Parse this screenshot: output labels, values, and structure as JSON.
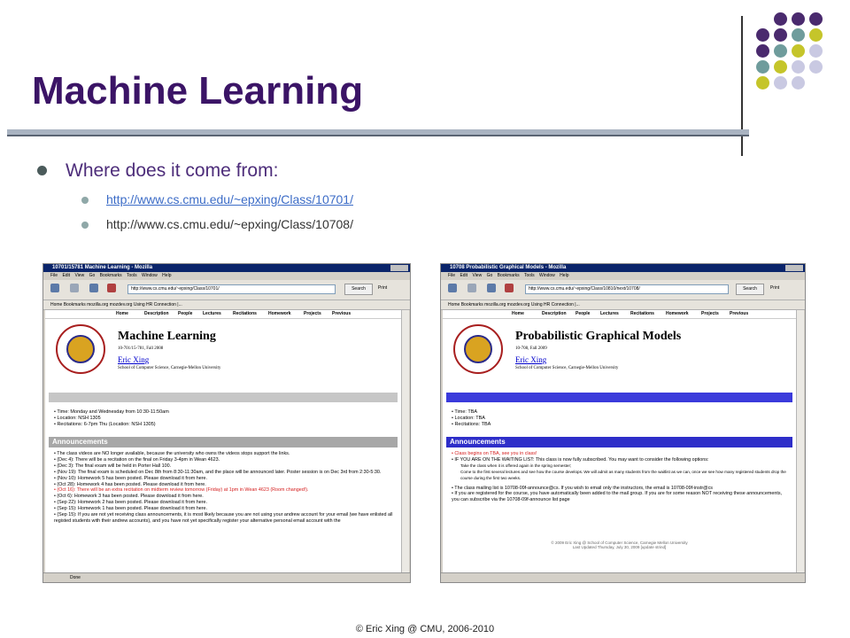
{
  "slide": {
    "title": "Machine Learning",
    "bullet": "Where does it come from:",
    "links": [
      "http://www.cs.cmu.edu/~epxing/Class/10701/",
      "http://www.cs.cmu.edu/~epxing/Class/10708/"
    ],
    "footer": "© Eric Xing @ CMU, 2006-2010",
    "colors": {
      "title": "#3b1466",
      "dot_purple": "#4a2a6e",
      "dot_teal": "#6f9c9c",
      "dot_lime": "#c5c52a",
      "dot_lavender": "#c9c9e2"
    }
  },
  "browser_left": {
    "title_bar": "10701/15781 Machine Learning - Mozilla",
    "menu": "File  Edit  View  Go  Bookmarks  Tools  Window  Help",
    "nav_labels": [
      "Back",
      "Forward",
      "Reload",
      "Stop"
    ],
    "address": "http://www.cs.cmu.edu/~epxing/Class/10701/",
    "search": "Search",
    "print": "Print",
    "bookmarks": "Home   Bookmarks   mozilla.org   mozdev.org   Using HR Connection |...",
    "tabs": [
      "Home",
      "Description",
      "People",
      "Lectures",
      "Recitations",
      "Homework",
      "Projects",
      "Previous"
    ],
    "course_title": "Machine Learning",
    "course_sub": "10-701/15-781, Fall 2008",
    "instructor": "Eric Xing",
    "school": "School of Computer Science, Carnegie-Mellon University",
    "info": [
      "• Time: Monday and Wednesday from 10:30-11:50am",
      "• Location: NSH 1305",
      "• Recitations: 6-7pm Thu (Location: NSH 1305)"
    ],
    "announcements_heading": "Announcements",
    "announcements": [
      "• The class videos are NO longer available, because the university who owns the videos stops support the links.",
      "• (Dec 4): There will be a recitation on the final on Friday 3-4pm in Wean 4623.",
      "• (Dec 3): The final exam will be held in Porter Hall 100.",
      "• (Nov 19): The final exam is scheduled on Dec 8th from 8:30-11:30am, and the place will be announced later. Poster session is on Dec 3rd from 2:30-5:30.",
      "• (Nov 10): Homework 5 has been posted. Please download it from here.",
      "• (Oct 28): Homework 4 has been posted. Please download it from here.",
      "• (Oct 16): There will be an extra recitation on midterm review tomorrow (Friday) at 1pm in Wean 4623 (Room changed!).",
      "• (Oct 6): Homework 3 has been posted. Please download it from here.",
      "• (Sep 22): Homework 2 has been posted. Please download it from here.",
      "• (Sep 15): Homework 1 has been posted. Please download it from here.",
      "• (Sep 15): If you are not yet receiving class announcements, it is most likely because you are not using your andrew account for your email (we have enlisted all registed students with their andrew accounts), and you have not yet specifically register your alternative personal email account with the"
    ],
    "status": "Done"
  },
  "browser_right": {
    "title_bar": "10708 Probabilistic Graphical Models - Mozilla",
    "menu": "File  Edit  View  Go  Bookmarks  Tools  Window  Help",
    "nav_labels": [
      "Back",
      "Forward",
      "Reload",
      "Stop"
    ],
    "address": "http://www.cs.cmu.edu/~epxing/Class/10810/next/10708/",
    "search": "Search",
    "print": "Print",
    "bookmarks": "Home   Bookmarks   mozilla.org   mozdev.org   Using HR Connection |...",
    "tabs": [
      "Home",
      "Description",
      "People",
      "Lectures",
      "Recitations",
      "Homework",
      "Projects",
      "Previous"
    ],
    "course_title": "Probabilistic Graphical Models",
    "course_sub": "10-708, Fall 2009",
    "instructor": "Eric Xing",
    "school": "School of Computer Science, Carnegie-Mellon University",
    "info": [
      "• Time: TBA",
      "• Location: TBA",
      "• Recitations: TBA"
    ],
    "announcements_heading": "Announcements",
    "announcements": [
      "• Class begins on TBA, see you in class!",
      "• IF YOU ARE ON THE WAITING LIST: This class is now fully subscribed. You may want to consider the following options:",
      "Take the class when it is offered again in the spring semester;",
      "Come to the first several lectures and see how the course develops. We will admit as many students from the waitlist as we can, once we see how many registered students drop the course during the first two weeks.",
      "• The class mailing list is 10708-09f-announce@cs. If you wish to email only the instructors, the email is 10708-09f-instr@cs",
      "• If you are registered for the course, you have automatically been added to the mail group. If you are for some reason NOT receiving these announcements, you can subscribe via the 10708-09f-announce list page"
    ],
    "page_footer": "© 2009 Eric Xing @ School of Computer Science, Carnegie Mellon University",
    "page_footer2": "Last Updated Thursday, July 30, 2009 [update strind]"
  }
}
